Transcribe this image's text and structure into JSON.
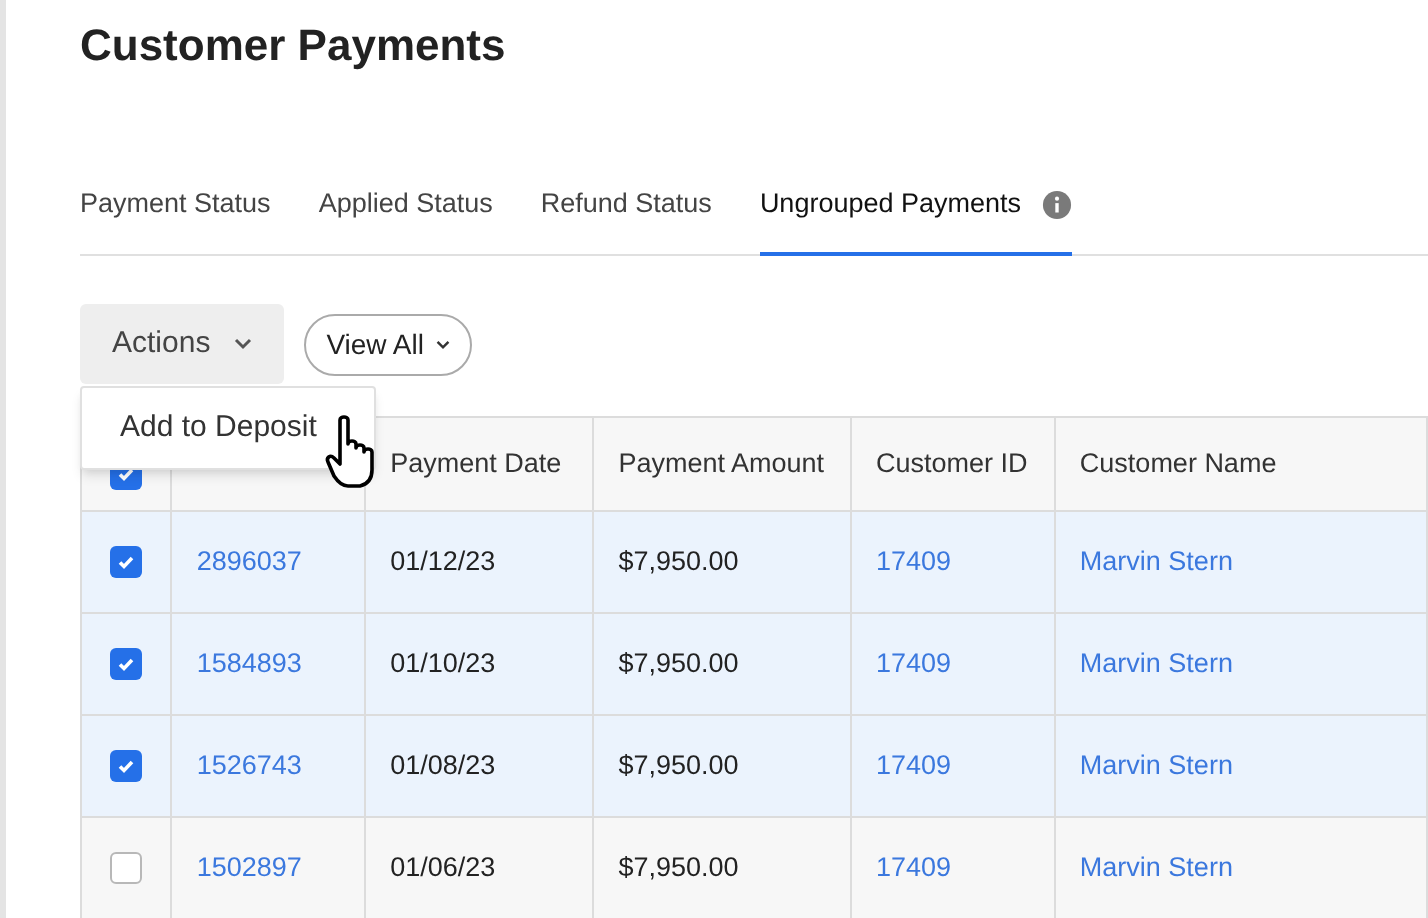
{
  "title": "Customer Payments",
  "tabs": [
    {
      "label": "Payment Status",
      "selected": false,
      "info": false
    },
    {
      "label": "Applied Status",
      "selected": false,
      "info": false
    },
    {
      "label": "Refund Status",
      "selected": false,
      "info": false
    },
    {
      "label": "Ungrouped Payments",
      "selected": true,
      "info": true
    }
  ],
  "actions": {
    "label": "Actions",
    "expanded": true,
    "menu": [
      "Add to Deposit"
    ]
  },
  "filter": {
    "label": "View All"
  },
  "table": {
    "select_all": {
      "checked": true
    },
    "columns": [
      "",
      "Payment Date",
      "Payment Amount",
      "Customer ID",
      "Customer Name"
    ],
    "rows": [
      {
        "checked": true,
        "cells": [
          "2896037",
          "01/12/23",
          "$7,950.00",
          "17409",
          "Marvin Stern"
        ]
      },
      {
        "checked": true,
        "cells": [
          "1584893",
          "01/10/23",
          "$7,950.00",
          "17409",
          "Marvin Stern"
        ]
      },
      {
        "checked": true,
        "cells": [
          "1526743",
          "01/08/23",
          "$7,950.00",
          "17409",
          "Marvin Stern"
        ]
      },
      {
        "checked": false,
        "cells": [
          "1502897",
          "01/06/23",
          "$7,950.00",
          "17409",
          "Marvin Stern"
        ]
      }
    ]
  }
}
